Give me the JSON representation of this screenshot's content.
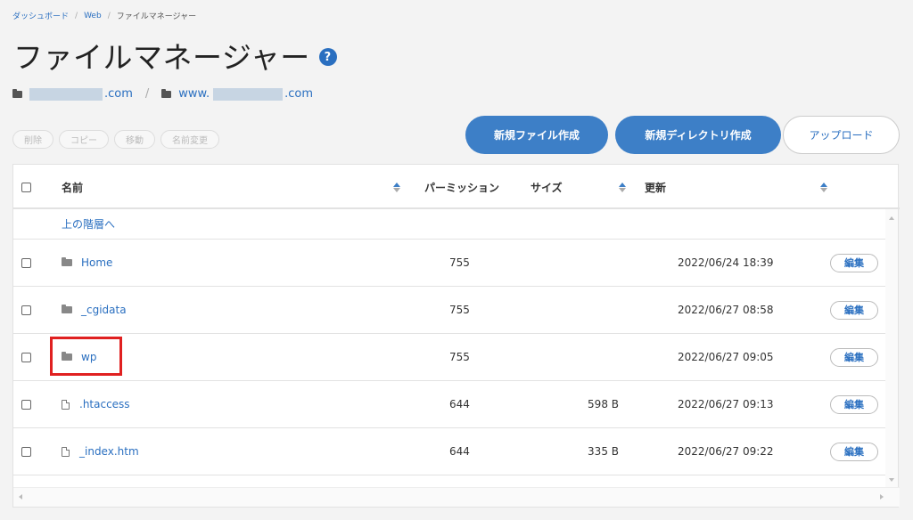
{
  "breadcrumb": {
    "home": "ダッシュボード",
    "web": "Web",
    "current": "ファイルマネージャー",
    "separator": "/"
  },
  "page": {
    "title": "ファイルマネージャー",
    "help": "?"
  },
  "domain_path": {
    "first_suffix": ".com",
    "separator": "/",
    "second_prefix": "www.",
    "second_suffix": ".com"
  },
  "actions": {
    "delete": "削除",
    "copy": "コピー",
    "move": "移動",
    "rename": "名前変更"
  },
  "toolbar": {
    "new_file": "新規ファイル作成",
    "new_dir": "新規ディレクトリ作成",
    "upload": "アップロード"
  },
  "table": {
    "headers": {
      "name": "名前",
      "permission": "パーミッション",
      "size": "サイズ",
      "updated": "更新"
    },
    "parent_link": "上の階層へ",
    "edit_label": "編集",
    "rows": [
      {
        "type": "folder",
        "name": "Home",
        "permission": "755",
        "size": "",
        "updated": "2022/06/24 18:39"
      },
      {
        "type": "folder",
        "name": "_cgidata",
        "permission": "755",
        "size": "",
        "updated": "2022/06/27 08:58"
      },
      {
        "type": "folder",
        "name": "wp",
        "permission": "755",
        "size": "",
        "updated": "2022/06/27 09:05",
        "highlighted": true
      },
      {
        "type": "file",
        "name": ".htaccess",
        "permission": "644",
        "size": "598 B",
        "updated": "2022/06/27 09:13"
      },
      {
        "type": "file",
        "name": "_index.htm",
        "permission": "644",
        "size": "335 B",
        "updated": "2022/06/27 09:22"
      }
    ]
  },
  "colors": {
    "accent": "#3d7fc7",
    "link": "#2a6fc0",
    "highlight": "#e02020",
    "background": "#f3f3f3"
  }
}
